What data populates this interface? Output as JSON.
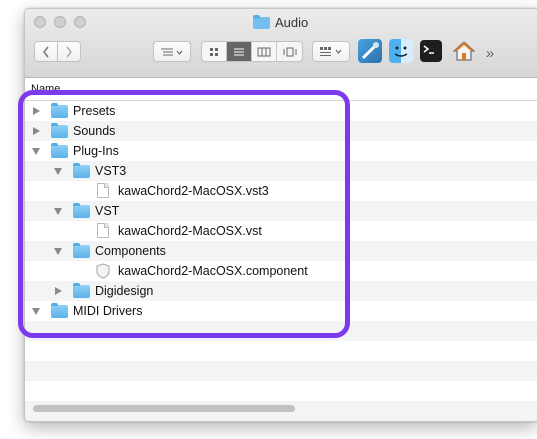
{
  "window": {
    "title": "Audio",
    "toolbar": {
      "back_icon": "chevron-left-icon",
      "forward_icon": "chevron-right-icon",
      "more_glyph": "»"
    }
  },
  "columns": {
    "name_header": "Name"
  },
  "files": [
    {
      "label": "Presets",
      "type": "folder",
      "expanded": false
    },
    {
      "label": "Sounds",
      "type": "folder",
      "expanded": false
    },
    {
      "label": "Plug-Ins",
      "type": "folder",
      "expanded": true
    },
    {
      "label": "VST3",
      "type": "folder",
      "expanded": true
    },
    {
      "label": "kawaChord2-MacOSX.vst3",
      "type": "file"
    },
    {
      "label": "VST",
      "type": "folder",
      "expanded": true
    },
    {
      "label": "kawaChord2-MacOSX.vst",
      "type": "file"
    },
    {
      "label": "Components",
      "type": "folder",
      "expanded": true
    },
    {
      "label": "kawaChord2-MacOSX.component",
      "type": "component"
    },
    {
      "label": "Digidesign",
      "type": "folder",
      "expanded": false
    },
    {
      "label": "MIDI Drivers",
      "type": "folder",
      "expanded": false
    }
  ],
  "colors": {
    "highlight": "#7c3aed",
    "folder": "#5ab3ea",
    "row_alt": "#f3f4f6"
  }
}
